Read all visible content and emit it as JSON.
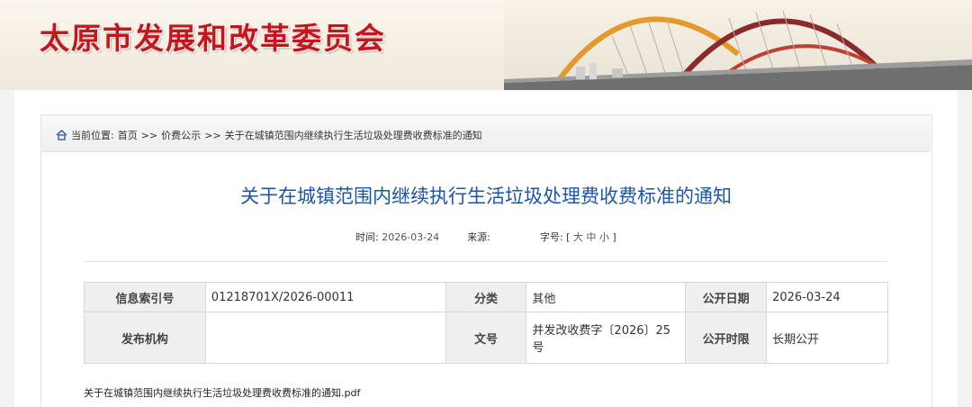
{
  "header": {
    "site_title": "太原市发展和改革委员会"
  },
  "breadcrumb": {
    "prefix": "当前位置:",
    "items": [
      "首页",
      "价费公示",
      "关于在城镇范围内继续执行生活垃圾处理费收费标准的通知"
    ],
    "separator": ">>"
  },
  "article": {
    "title": "关于在城镇范围内继续执行生活垃圾处理费收费标准的通知",
    "meta": {
      "time_label": "时间:",
      "time_value": "2026-03-24",
      "source_label": "来源:",
      "source_value": "",
      "fontsize_label": "字号:",
      "fontsize_open": "[",
      "fontsize_options": [
        "大",
        "中",
        "小"
      ],
      "fontsize_close": "]"
    }
  },
  "info_table": {
    "index_label": "信息索引号",
    "index_value": "01218701X/2026-00011",
    "category_label": "分类",
    "category_value": "其他",
    "pubdate_label": "公开日期",
    "pubdate_value": "2026-03-24",
    "issuer_label": "发布机构",
    "issuer_value": "",
    "docno_label": "文号",
    "docno_value": "并发改收费字〔2026〕25号",
    "period_label": "公开时限",
    "period_value": "长期公开"
  },
  "attachment": {
    "filename": "关于在城镇范围内继续执行生活垃圾处理费收费标准的通知.pdf"
  },
  "colors": {
    "title_red": "#c4161c",
    "article_blue": "#1b55a8",
    "label_bg": "#efefef"
  }
}
